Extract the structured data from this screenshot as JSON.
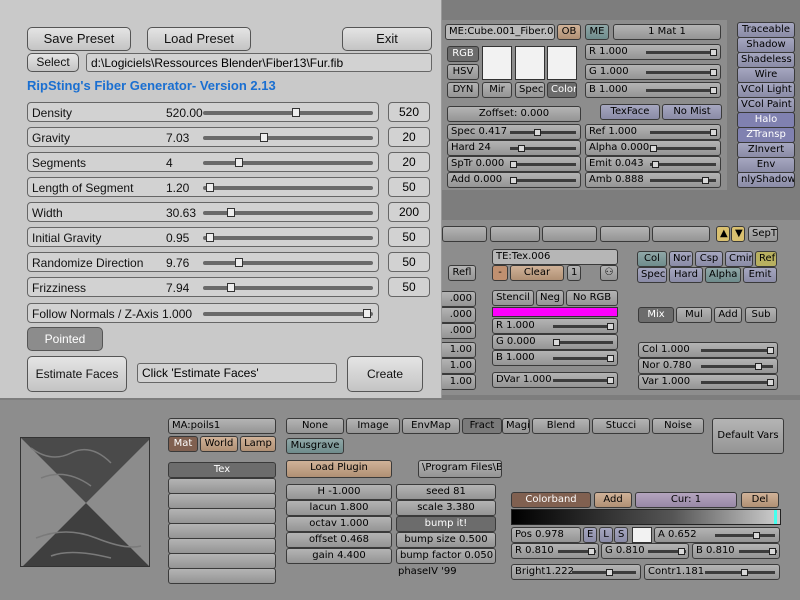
{
  "fiber": {
    "save_preset": "Save Preset",
    "load_preset": "Load Preset",
    "exit": "Exit",
    "select": "Select",
    "path": "d:\\Logiciels\\Ressources Blender\\Fiber13\\Fur.fib",
    "title": "RipSting's Fiber Generator-  Version 2.13",
    "rows": [
      {
        "label": "Density",
        "value": "520.00",
        "slider": 0.55,
        "max": "520"
      },
      {
        "label": "Gravity",
        "value": "7.03",
        "slider": 0.35,
        "max": "20"
      },
      {
        "label": "Segments",
        "value": "4",
        "slider": 0.2,
        "max": "20"
      },
      {
        "label": "Length of Segment",
        "value": "1.20",
        "slider": 0.02,
        "max": "50"
      },
      {
        "label": "Width",
        "value": "30.63",
        "slider": 0.15,
        "max": "200"
      },
      {
        "label": "Initial Gravity",
        "value": "0.95",
        "slider": 0.02,
        "max": "50"
      },
      {
        "label": "Randomize Direction",
        "value": "9.76",
        "slider": 0.2,
        "max": "50"
      },
      {
        "label": "Frizziness",
        "value": "7.94",
        "slider": 0.15,
        "max": "50"
      }
    ],
    "follow_normals": "Follow Normals / Z-Axis 1.000",
    "pointed": "Pointed",
    "estimate_faces": "Estimate Faces",
    "estimate_status": "Click 'Estimate Faces'",
    "create": "Create"
  },
  "material": {
    "me_name": "ME:Cube.001_Fiber.0",
    "ob": "OB",
    "me": "ME",
    "mat_count": "1 Mat 1",
    "rgb": "RGB",
    "hsv": "HSV",
    "dyn": "DYN",
    "mir": "Mir",
    "spec": "Spec",
    "color": "Color",
    "r": "R 1.000",
    "g": "G 1.000",
    "b": "B 1.000",
    "texface": "TexFace",
    "nomist": "No Mist",
    "zoffset": "Zoffset: 0.000",
    "spec_v": "Spec 0.417",
    "hard": "Hard 24",
    "sptr": "SpTr 0.000",
    "add": "Add  0.000",
    "ref": "Ref  1.000",
    "alpha": "Alpha 0.000",
    "emit": "Emit  0.043",
    "amb": "Amb   0.888",
    "modes": [
      "Traceable",
      "Shadow",
      "Shadeless",
      "Wire",
      "VCol Light",
      "VCol Paint",
      "Halo",
      "ZTransp",
      "ZInvert",
      "Env",
      "nlyShadow"
    ]
  },
  "texmap": {
    "tab_last": "SepT",
    "tex_name": "TE:Tex.006",
    "clear": "Clear",
    "users": "1",
    "stencil": "Stencil",
    "neg": "Neg",
    "norgb": "No RGB",
    "r": "R 1.000",
    "g": "G 0.000",
    "b": "B 1.000",
    "dvar": "DVar 1.000",
    "left_vals": [
      ".000",
      ".000",
      ".000",
      "1.00",
      "1.00",
      "1.00",
      ".000"
    ],
    "refl": "Refl",
    "col": "Col",
    "nor": "Nor",
    "csp": "Csp",
    "cmir": "Cmir",
    "ref": "Ref",
    "spec": "Spec",
    "hard": "Hard",
    "alpha": "Alpha",
    "emit": "Emit",
    "mix": "Mix",
    "mul": "Mul",
    "add": "Add",
    "sub": "Sub",
    "colv": "Col 1.000",
    "norv": "Nor 0.780",
    "varv": "Var 1.000"
  },
  "texture": {
    "ma_name": "MA:poils1",
    "mat": "Mat",
    "world": "World",
    "lamp": "Lamp",
    "tex": "Tex",
    "types": [
      "None",
      "Image",
      "EnvMap",
      "Fract"
    ],
    "types2": [
      "Magic",
      "Blend",
      "Stucci",
      "Noise"
    ],
    "musgrave": "Musgrave",
    "default_vars": "Default Vars",
    "load_plugin": "Load Plugin",
    "plugin_path": "\\Program Files\\Ble",
    "params_left": [
      "H -1.000",
      "lacun 1.800",
      "octav 1.000",
      "offset 0.468",
      "gain 4.400"
    ],
    "params_right": [
      "seed 81",
      "scale 3.380",
      "bump it!",
      "bump size 0.500",
      "bump factor 0.050"
    ],
    "credit": "phaseIV  '99",
    "colorband": "Colorband",
    "cb_add": "Add",
    "cur": "Cur: 1",
    "del": "Del",
    "pos": "Pos 0.978",
    "e": "E",
    "l": "L",
    "s": "S",
    "a": "A 0.652",
    "r": "R 0.810",
    "g": "G 0.810",
    "b": "B 0.810",
    "bright": "Bright1.222",
    "contr": "Contr1.181"
  },
  "colors": {
    "fiber_title": "#1a6fd1",
    "magenta": "#ff00ff"
  }
}
